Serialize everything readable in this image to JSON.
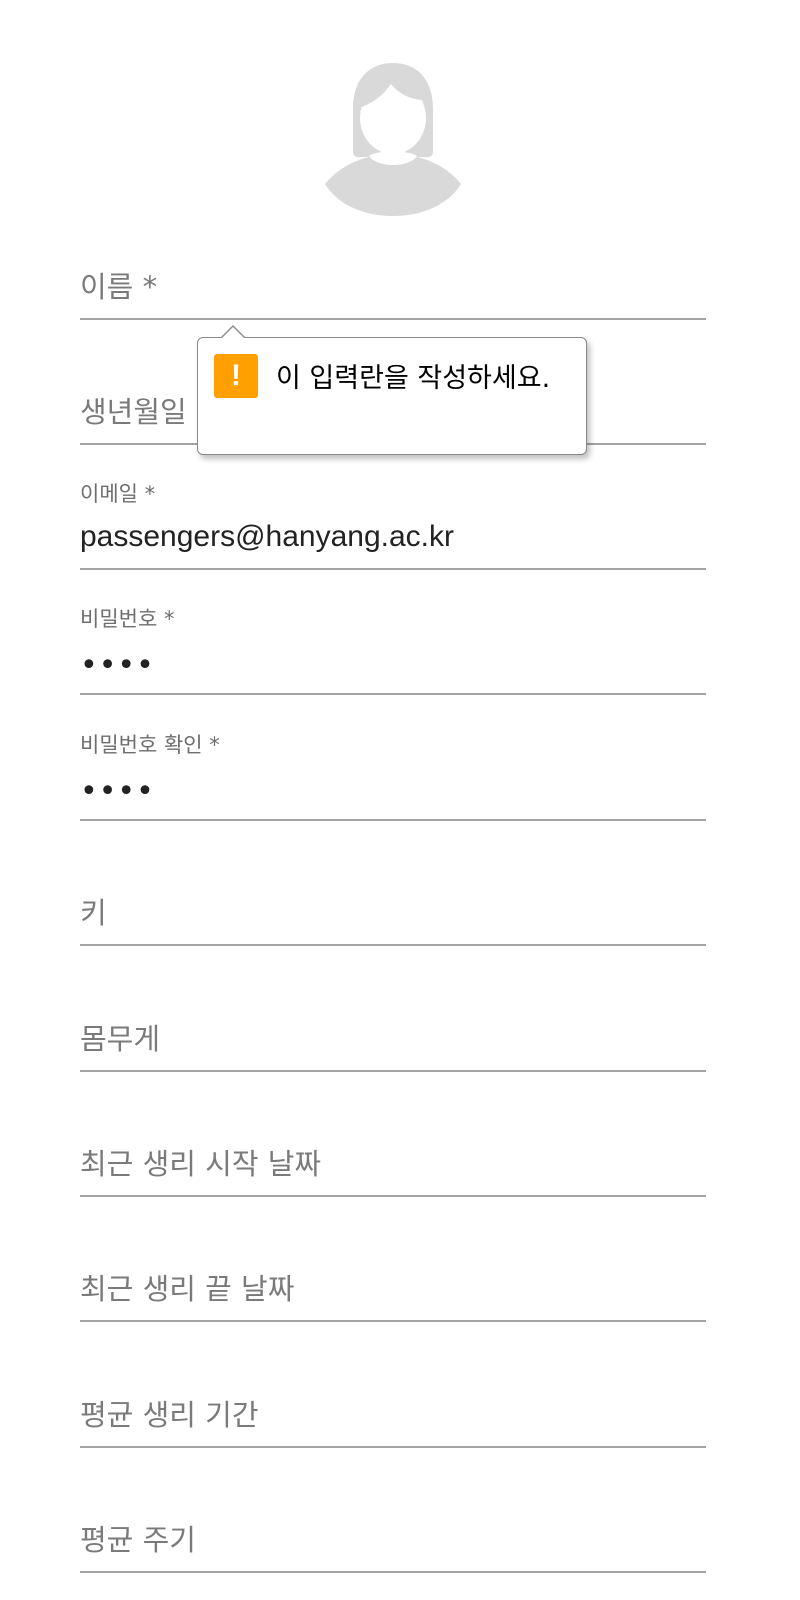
{
  "avatar": {
    "icon": "female-user-icon",
    "color": "#d9d9d9"
  },
  "form": {
    "name": {
      "placeholder": "이름 *"
    },
    "birthdate": {
      "placeholder": "생년월일"
    },
    "email": {
      "label": "이메일 *",
      "value": "passengers@hanyang.ac.kr"
    },
    "password": {
      "label": "비밀번호 *",
      "value": "••••"
    },
    "password_confirm": {
      "label": "비밀번호 확인 *",
      "value": "••••"
    },
    "height": {
      "placeholder": "키"
    },
    "weight": {
      "placeholder": "몸무게"
    },
    "last_period_start": {
      "placeholder": "최근 생리 시작 날짜"
    },
    "last_period_end": {
      "placeholder": "최근 생리 끝 날짜"
    },
    "avg_period_length": {
      "placeholder": "평균 생리 기간"
    },
    "avg_cycle": {
      "placeholder": "평균 주기"
    }
  },
  "validation_tooltip": {
    "icon": "warning-icon",
    "icon_glyph": "!",
    "accent_color": "#ffa000",
    "message": "이 입력란을 작성하세요."
  }
}
